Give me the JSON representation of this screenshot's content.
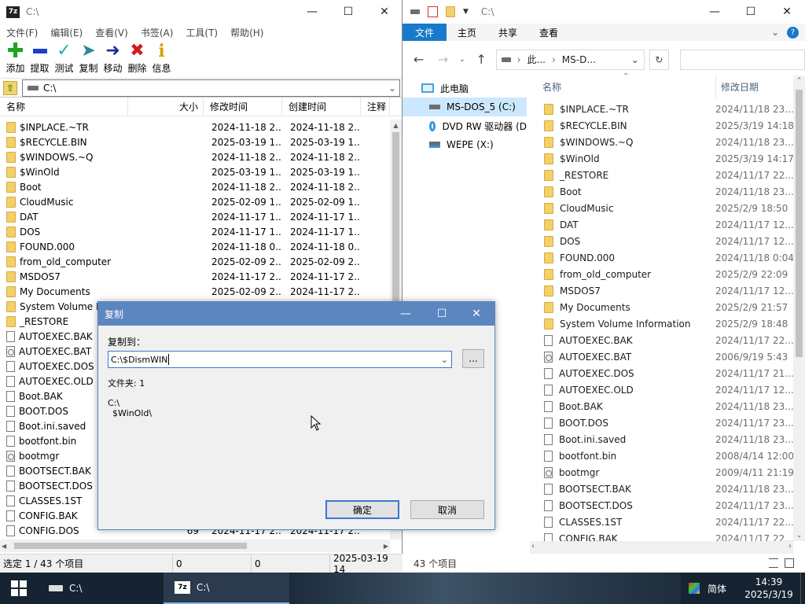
{
  "zip": {
    "title": "C:\\",
    "logo": "7z",
    "menu": [
      "文件(F)",
      "编辑(E)",
      "查看(V)",
      "书签(A)",
      "工具(T)",
      "帮助(H)"
    ],
    "toolbar": [
      {
        "label": "添加",
        "icon": "plus-icon",
        "color": "#21a026"
      },
      {
        "label": "提取",
        "icon": "minus-icon",
        "color": "#1f3fc4"
      },
      {
        "label": "测试",
        "icon": "check-icon",
        "color": "#2aa8b8"
      },
      {
        "label": "复制",
        "icon": "copy-arrow-icon",
        "color": "#2a8a9a"
      },
      {
        "label": "移动",
        "icon": "move-arrow-icon",
        "color": "#1b2f9a"
      },
      {
        "label": "删除",
        "icon": "delete-x-icon",
        "color": "#d41a1a"
      },
      {
        "label": "信息",
        "icon": "info-icon",
        "color": "#d6a400"
      }
    ],
    "path": "C:\\",
    "columns": {
      "name": "名称",
      "size": "大小",
      "modified": "修改时间",
      "created": "创建时间",
      "comment": "注释"
    },
    "files": [
      {
        "name": "$INPLACE.~TR",
        "type": "folder",
        "size": "",
        "modified": "2024-11-18 2...",
        "created": "2024-11-18 2..."
      },
      {
        "name": "$RECYCLE.BIN",
        "type": "folder",
        "size": "",
        "modified": "2025-03-19 1...",
        "created": "2025-03-19 1..."
      },
      {
        "name": "$WINDOWS.~Q",
        "type": "folder",
        "size": "",
        "modified": "2024-11-18 2...",
        "created": "2024-11-18 2..."
      },
      {
        "name": "$WinOld",
        "type": "folder",
        "size": "",
        "modified": "2025-03-19 1...",
        "created": "2025-03-19 1..."
      },
      {
        "name": "Boot",
        "type": "folder",
        "size": "",
        "modified": "2024-11-18 2...",
        "created": "2024-11-18 2..."
      },
      {
        "name": "CloudMusic",
        "type": "folder",
        "size": "",
        "modified": "2025-02-09 1...",
        "created": "2025-02-09 1..."
      },
      {
        "name": "DAT",
        "type": "folder",
        "size": "",
        "modified": "2024-11-17 1...",
        "created": "2024-11-17 1..."
      },
      {
        "name": "DOS",
        "type": "folder",
        "size": "",
        "modified": "2024-11-17 1...",
        "created": "2024-11-17 1..."
      },
      {
        "name": "FOUND.000",
        "type": "folder",
        "size": "",
        "modified": "2024-11-18 0...",
        "created": "2024-11-18 0..."
      },
      {
        "name": "from_old_computer",
        "type": "folder",
        "size": "",
        "modified": "2025-02-09 2...",
        "created": "2025-02-09 2..."
      },
      {
        "name": "MSDOS7",
        "type": "folder",
        "size": "",
        "modified": "2024-11-17 2...",
        "created": "2024-11-17 2..."
      },
      {
        "name": "My Documents",
        "type": "folder",
        "size": "",
        "modified": "2025-02-09 2...",
        "created": "2024-11-17 2..."
      },
      {
        "name": "System Volume In",
        "type": "folder",
        "size": "",
        "modified": "",
        "created": ""
      },
      {
        "name": "_RESTORE",
        "type": "folder",
        "size": "",
        "modified": "",
        "created": ""
      },
      {
        "name": "AUTOEXEC.BAK",
        "type": "file",
        "size": "",
        "modified": "",
        "created": ""
      },
      {
        "name": "AUTOEXEC.BAT",
        "type": "gear",
        "size": "",
        "modified": "",
        "created": ""
      },
      {
        "name": "AUTOEXEC.DOS",
        "type": "file",
        "size": "",
        "modified": "",
        "created": ""
      },
      {
        "name": "AUTOEXEC.OLD",
        "type": "file",
        "size": "",
        "modified": "",
        "created": ""
      },
      {
        "name": "Boot.BAK",
        "type": "file",
        "size": "",
        "modified": "",
        "created": ""
      },
      {
        "name": "BOOT.DOS",
        "type": "file",
        "size": "",
        "modified": "",
        "created": ""
      },
      {
        "name": "Boot.ini.saved",
        "type": "file",
        "size": "",
        "modified": "",
        "created": ""
      },
      {
        "name": "bootfont.bin",
        "type": "file",
        "size": "",
        "modified": "",
        "created": ""
      },
      {
        "name": "bootmgr",
        "type": "gear",
        "size": "",
        "modified": "",
        "created": ""
      },
      {
        "name": "BOOTSECT.BAK",
        "type": "file",
        "size": "",
        "modified": "",
        "created": ""
      },
      {
        "name": "BOOTSECT.DOS",
        "type": "file",
        "size": "",
        "modified": "",
        "created": ""
      },
      {
        "name": "CLASSES.1ST",
        "type": "file",
        "size": "",
        "modified": "",
        "created": ""
      },
      {
        "name": "CONFIG.BAK",
        "type": "file",
        "size": "",
        "modified": "",
        "created": ""
      },
      {
        "name": "CONFIG.DOS",
        "type": "file",
        "size": "69",
        "modified": "2024-11-17 2...",
        "created": "2024-11-17 2..."
      }
    ],
    "status": {
      "selection": "选定 1 / 43 个项目",
      "size1": "0",
      "size2": "0",
      "date": "2025-03-19 14"
    }
  },
  "explorer": {
    "title": "C:\\",
    "tabs": [
      "文件",
      "主页",
      "共享",
      "查看"
    ],
    "address": {
      "crumb1": "此...",
      "crumb2": "MS-D..."
    },
    "nav": [
      {
        "label": "此电脑",
        "icon": "pc-icon",
        "selected": false
      },
      {
        "label": "MS-DOS_5 (C:)",
        "icon": "drive-icon",
        "selected": true
      },
      {
        "label": "DVD RW 驱动器 (D",
        "icon": "dvd-icon",
        "selected": false
      },
      {
        "label": "WEPE (X:)",
        "icon": "network-drive-icon",
        "selected": false
      }
    ],
    "columns": {
      "name": "名称",
      "date": "修改日期"
    },
    "files": [
      {
        "name": "$INPLACE.~TR",
        "type": "folder",
        "date": "2024/11/18 23..."
      },
      {
        "name": "$RECYCLE.BIN",
        "type": "folder",
        "date": "2025/3/19 14:18"
      },
      {
        "name": "$WINDOWS.~Q",
        "type": "folder",
        "date": "2024/11/18 23..."
      },
      {
        "name": "$WinOld",
        "type": "folder",
        "date": "2025/3/19 14:17"
      },
      {
        "name": "_RESTORE",
        "type": "folder",
        "date": "2024/11/17 22..."
      },
      {
        "name": "Boot",
        "type": "folder",
        "date": "2024/11/18 23..."
      },
      {
        "name": "CloudMusic",
        "type": "folder",
        "date": "2025/2/9 18:50"
      },
      {
        "name": "DAT",
        "type": "folder",
        "date": "2024/11/17 12..."
      },
      {
        "name": "DOS",
        "type": "folder",
        "date": "2024/11/17 12..."
      },
      {
        "name": "FOUND.000",
        "type": "folder",
        "date": "2024/11/18 0:04"
      },
      {
        "name": "from_old_computer",
        "type": "folder",
        "date": "2025/2/9 22:09"
      },
      {
        "name": "MSDOS7",
        "type": "folder",
        "date": "2024/11/17 12..."
      },
      {
        "name": "My Documents",
        "type": "folder",
        "date": "2025/2/9 21:57"
      },
      {
        "name": "System Volume Information",
        "type": "folder",
        "date": "2025/2/9 18:48"
      },
      {
        "name": "AUTOEXEC.BAK",
        "type": "file",
        "date": "2024/11/17 22..."
      },
      {
        "name": "AUTOEXEC.BAT",
        "type": "gear",
        "date": "2006/9/19 5:43"
      },
      {
        "name": "AUTOEXEC.DOS",
        "type": "file",
        "date": "2024/11/17 21..."
      },
      {
        "name": "AUTOEXEC.OLD",
        "type": "file",
        "date": "2024/11/17 12..."
      },
      {
        "name": "Boot.BAK",
        "type": "file",
        "date": "2024/11/18 23..."
      },
      {
        "name": "BOOT.DOS",
        "type": "file",
        "date": "2024/11/17 23..."
      },
      {
        "name": "Boot.ini.saved",
        "type": "file",
        "date": "2024/11/18 23..."
      },
      {
        "name": "bootfont.bin",
        "type": "file",
        "date": "2008/4/14 12:00"
      },
      {
        "name": "bootmgr",
        "type": "gear",
        "date": "2009/4/11 21:19"
      },
      {
        "name": "BOOTSECT.BAK",
        "type": "file",
        "date": "2024/11/18 23..."
      },
      {
        "name": "BOOTSECT.DOS",
        "type": "file",
        "date": "2024/11/17 23..."
      },
      {
        "name": "CLASSES.1ST",
        "type": "file",
        "date": "2024/11/17 22..."
      },
      {
        "name": "CONFIG.BAK",
        "type": "file",
        "date": "2024/11/17 22..."
      }
    ],
    "status": "43 个项目"
  },
  "dialog": {
    "title": "复制",
    "copy_to_label": "复制到：",
    "destination": "C:\\$DismWIN",
    "browse_label": "...",
    "folder_count": "文件夹: 1",
    "source_line1": "C:\\",
    "source_line2": "$WinOld\\",
    "ok_label": "确定",
    "cancel_label": "取消"
  },
  "taskbar": {
    "task1": "C:\\",
    "task2": "C:\\",
    "task2_logo": "7z",
    "ime": "简体",
    "time": "14:39",
    "date": "2025/3/19"
  }
}
